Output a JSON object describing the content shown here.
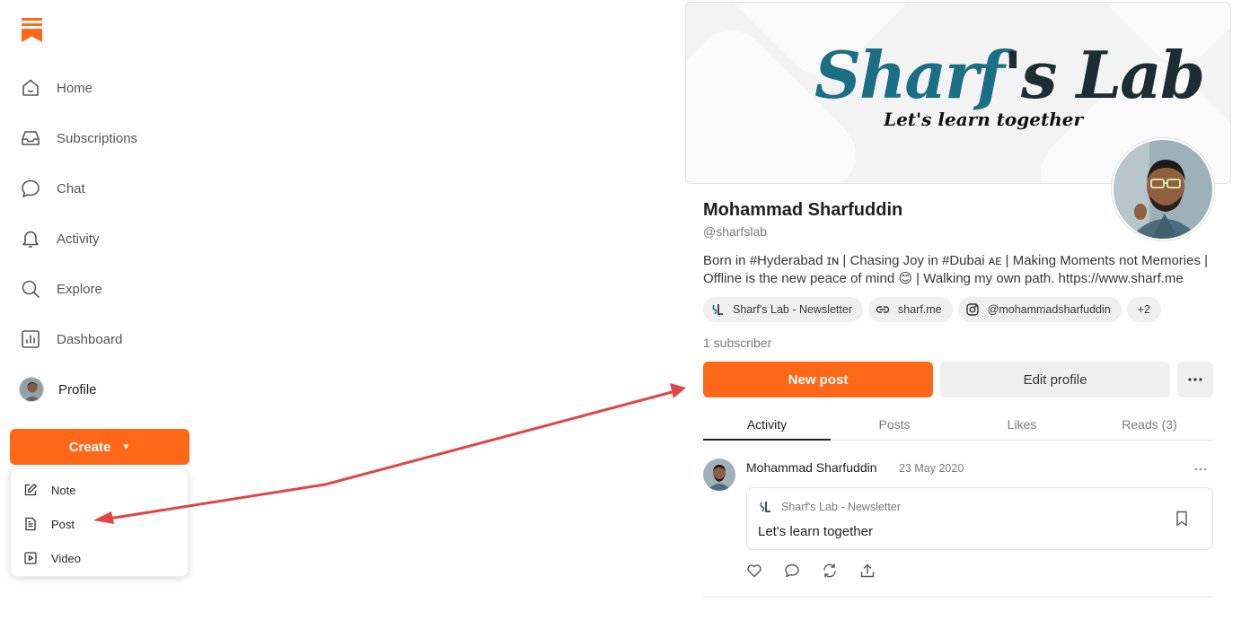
{
  "brand": {
    "accent": "#ff6719",
    "arrow_color": "#e04545"
  },
  "sidebar": {
    "items": [
      {
        "label": "Home",
        "icon": "home-icon"
      },
      {
        "label": "Subscriptions",
        "icon": "inbox-icon"
      },
      {
        "label": "Chat",
        "icon": "chat-bubble-icon"
      },
      {
        "label": "Activity",
        "icon": "bell-icon"
      },
      {
        "label": "Explore",
        "icon": "search-icon"
      },
      {
        "label": "Dashboard",
        "icon": "bar-chart-icon"
      },
      {
        "label": "Profile",
        "icon": "avatar"
      }
    ],
    "create_label": "Create",
    "create_menu": [
      {
        "label": "Note",
        "icon": "pencil-square-icon"
      },
      {
        "label": "Post",
        "icon": "document-icon"
      },
      {
        "label": "Video",
        "icon": "video-icon"
      }
    ]
  },
  "banner": {
    "title_part1": "Sharf",
    "title_part2": "'s Lab",
    "tagline": "Let's learn together"
  },
  "profile": {
    "name": "Mohammad Sharfuddin",
    "handle": "@sharfslab",
    "bio": "Born in #Hyderabad ɪɴ | Chasing Joy in #Dubai ᴀᴇ | Making Moments not Memories | Offline is the new peace of mind 😊 | Walking my own path. https://www.sharf.me",
    "chips": [
      {
        "label": "Sharf's Lab - Newsletter",
        "icon": "publication-logo"
      },
      {
        "label": "sharf.me",
        "icon": "link-icon"
      },
      {
        "label": "@mohammadsharfuddin",
        "icon": "instagram-icon"
      },
      {
        "label": "+2"
      }
    ],
    "subscribers": "1 subscriber",
    "new_post_label": "New post",
    "edit_profile_label": "Edit profile"
  },
  "tabs": [
    {
      "label": "Activity",
      "active": true
    },
    {
      "label": "Posts"
    },
    {
      "label": "Likes"
    },
    {
      "label": "Reads (3)"
    }
  ],
  "feed": {
    "author": "Mohammad Sharfuddin",
    "date": "23 May 2020",
    "embed": {
      "publication": "Sharf's Lab - Newsletter",
      "title": "Let's learn together"
    },
    "actions": [
      "heart-icon",
      "comment-icon",
      "restack-icon",
      "share-icon"
    ]
  }
}
